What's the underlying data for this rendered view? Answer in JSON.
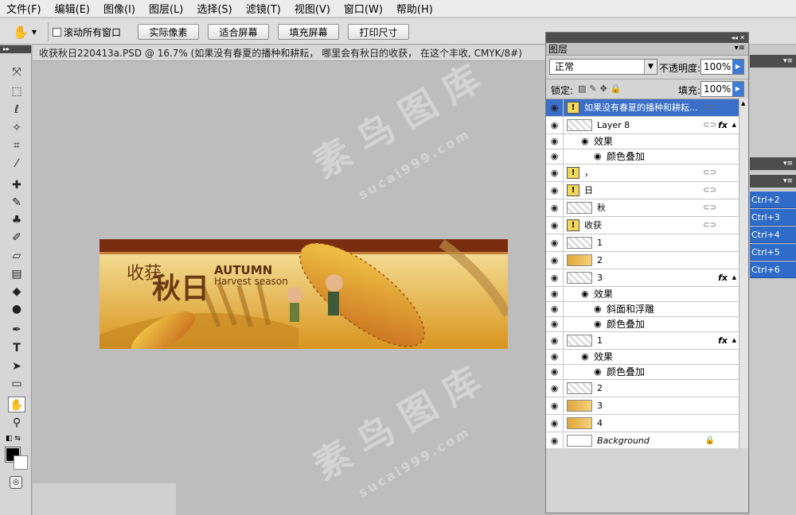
{
  "menu": [
    "文件(F)",
    "编辑(E)",
    "图像(I)",
    "图层(L)",
    "选择(S)",
    "滤镜(T)",
    "视图(V)",
    "窗口(W)",
    "帮助(H)"
  ],
  "options": {
    "tool_icon": "hand-icon",
    "scroll_all_label": "滚动所有窗口",
    "buttons": [
      "实际像素",
      "适合屏幕",
      "填充屏幕",
      "打印尺寸"
    ]
  },
  "document": {
    "tab_title": "收获秋日220413a.PSD @ 16.7% (如果没有春夏的播种和耕耘， 哪里会有秋日的收获， 在这个丰收, CMYK/8#)",
    "banner": {
      "title_cn_1": "收获",
      "title_cn_2": "秋日",
      "title_en_1": "AUTUMN",
      "title_en_2": "Harvest season"
    }
  },
  "watermark": {
    "text": "素 鸟 图 库",
    "sub": "sucai999.com"
  },
  "layers_panel": {
    "tab": "图层",
    "blend_mode": "正常",
    "opacity_label": "不透明度:",
    "opacity": "100%",
    "lock_label": "锁定:",
    "fill_label": "填充:",
    "fill": "100%",
    "layers": [
      {
        "name": "如果没有春夏的播种和耕耘...",
        "thumb": "warn",
        "selected": true,
        "link": true
      },
      {
        "name": "Layer 8",
        "thumb": "checker",
        "link": true,
        "fx": true
      },
      {
        "sub": true,
        "level": 1,
        "name": "效果"
      },
      {
        "sub": true,
        "level": 2,
        "name": "颜色叠加"
      },
      {
        "name": "，",
        "thumb": "warn",
        "link": true
      },
      {
        "name": "日",
        "thumb": "warn",
        "link": true
      },
      {
        "name": "秋",
        "thumb": "checker",
        "link": true
      },
      {
        "name": "收获",
        "thumb": "warn",
        "link": true
      },
      {
        "name": "1",
        "thumb": "checker"
      },
      {
        "name": "2",
        "thumb": "img"
      },
      {
        "name": "3",
        "thumb": "checker",
        "fx": true
      },
      {
        "sub": true,
        "level": 1,
        "name": "效果"
      },
      {
        "sub": true,
        "level": 2,
        "name": "斜面和浮雕"
      },
      {
        "sub": true,
        "level": 2,
        "name": "颜色叠加"
      },
      {
        "name": "1",
        "thumb": "checker",
        "fx": true
      },
      {
        "sub": true,
        "level": 1,
        "name": "效果"
      },
      {
        "sub": true,
        "level": 2,
        "name": "颜色叠加"
      },
      {
        "name": "2",
        "thumb": "checker"
      },
      {
        "name": "3",
        "thumb": "img"
      },
      {
        "name": "4",
        "thumb": "img"
      },
      {
        "name": "Background",
        "thumb": "white",
        "lock": true,
        "bg": true
      }
    ]
  },
  "shortcuts": [
    "Ctrl+2",
    "Ctrl+3",
    "Ctrl+4",
    "Ctrl+5",
    "Ctrl+6"
  ]
}
